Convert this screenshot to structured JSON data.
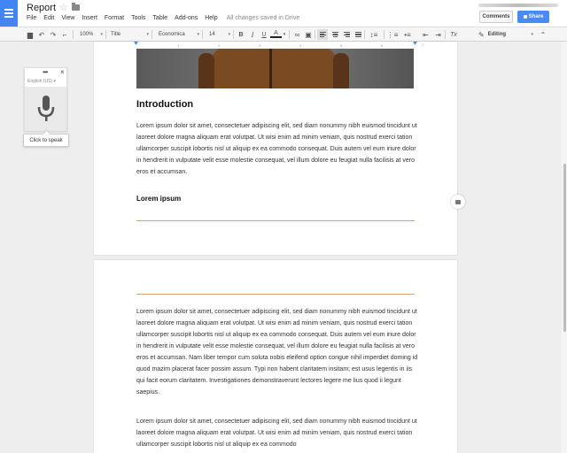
{
  "header": {
    "title": "Report",
    "menu": [
      "File",
      "Edit",
      "View",
      "Insert",
      "Format",
      "Tools",
      "Table",
      "Add-ons",
      "Help"
    ],
    "save_status": "All changes saved in Drive",
    "comments_label": "Comments",
    "share_label": "Share"
  },
  "toolbar": {
    "zoom": "100%",
    "style": "Title",
    "font": "Economica",
    "size": "14",
    "bold": "B",
    "italic": "I",
    "underline": "U",
    "text_color": "A",
    "clear_format": "Tx",
    "mode": "Editing"
  },
  "ruler": {
    "ticks": [
      "1",
      "2",
      "3",
      "4",
      "5",
      "6",
      "7"
    ]
  },
  "voice": {
    "menu_dots": "•••",
    "close": "×",
    "language": "English (US)",
    "tooltip": "Click to speak"
  },
  "document": {
    "intro_heading": "Introduction",
    "para1": "Lorem ipsum dolor sit amet, consectetuer adipiscing elit, sed diam nonummy nibh euismod tincidunt ut laoreet dolore magna aliquam erat volutpat. Ut wisi enim ad minim veniam, quis nostrud exerci tation ullamcorper suscipit lobortis nisl ut aliquip ex ea commodo consequat. Duis autem vel eum iriure dolor in hendrerit in vulputate velit esse molestie consequat, vel illum dolore eu feugiat nulla facilisis at vero eros et accumsan.",
    "subheading": "Lorem ipsum",
    "para2": "Lorem ipsum dolor sit amet, consectetuer adipiscing elit, sed diam nonummy nibh euismod tincidunt ut laoreet dolore magna aliquam erat volutpat. Ut wisi enim ad minim veniam, quis nostrud exerci tation ullamcorper suscipit lobortis nisl ut aliquip ex ea commodo consequat. Duis autem vel eum iriure dolor in hendrerit in vulputate velit esse molestie consequat, vel illum dolore eu feugiat nulla facilisis at vero eros et accumsan. Nam liber tempor cum soluta nobis eleifend option congue nihil imperdiet doming id quod mazim placerat facer possim assum. Typi non habent claritatem insitam; est usus legentis in iis qui facit eorum claritatem. Investigationes demonstraverunt lectores legere me lius quod ii legunt saepius.",
    "para3": "Lorem ipsum dolor sit amet, consectetuer adipiscing elit, sed diam nonummy nibh euismod tincidunt ut laoreet dolore magna aliquam erat volutpat. Ut wisi enim ad minim veniam, quis nostrud exerci tation ullamcorper suscipit lobortis nisl ut aliquip ex ea commodo"
  },
  "colors": {
    "accent": "#4285f4",
    "share": "#4a8af4",
    "rule": "#c8a678"
  }
}
